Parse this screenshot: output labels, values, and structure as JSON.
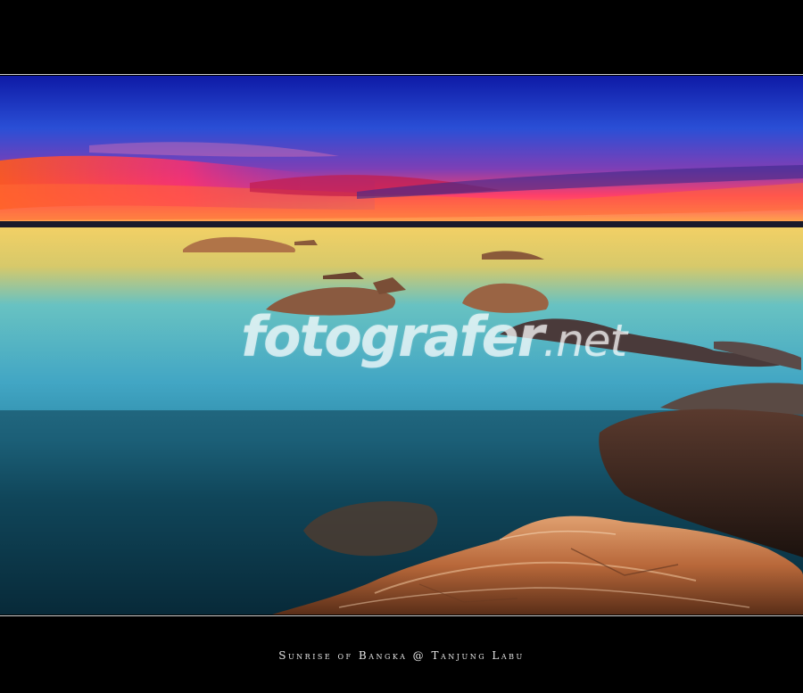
{
  "watermark": {
    "brand": "fotografer",
    "suffix": ".net"
  },
  "caption": {
    "text": "Sunrise of Bangka @ Tanjung Labu"
  },
  "colors": {
    "frame": "#000000",
    "rule": "#cfcfcf",
    "sky_top": "#1a1fb0",
    "sky_mid": "#2a54d8",
    "horizon_orange": "#ff6a1e",
    "horizon_pink": "#ff2f6e",
    "water_gold": "#e0c256",
    "water_teal": "#3a9cb8",
    "water_deep": "#0b3a4c",
    "rock": "#b86a3a"
  }
}
